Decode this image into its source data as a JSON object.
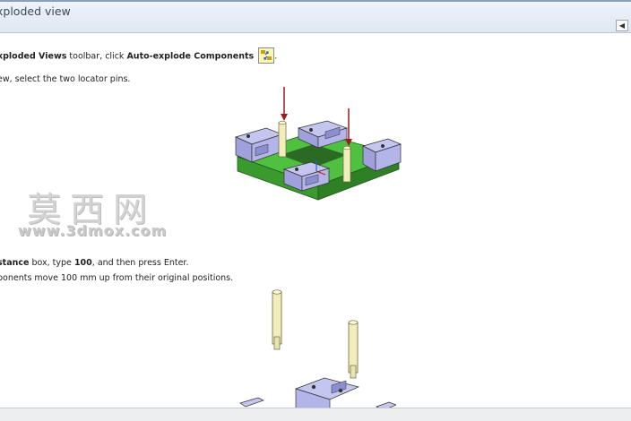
{
  "window": {
    "title": "xploded view"
  },
  "nav": {
    "back_glyph": "◀"
  },
  "step1": {
    "part1": "xploded Views",
    "part2": " toolbar, click ",
    "part3": "Auto-explode Components",
    "part4": "."
  },
  "step2": {
    "text": "ew, select the two locator pins."
  },
  "step3": {
    "part1": "stance",
    "part2": " box, type ",
    "part3": "100",
    "part4": ", and then press Enter."
  },
  "step4": {
    "text": "ponents move 100 mm up from their original positions."
  },
  "watermark": {
    "cn": "莫西网",
    "url": "www.3dmox.com"
  },
  "icons": {
    "toolbar": "auto-explode-components-icon",
    "back": "back-arrow-icon"
  },
  "colors": {
    "titlebar": "#e4ebf4",
    "part_purple": "#b3b4e8",
    "base_green": "#45b83a",
    "pin_beige": "#f2eebb",
    "arrow_red": "#9b1c1c"
  }
}
